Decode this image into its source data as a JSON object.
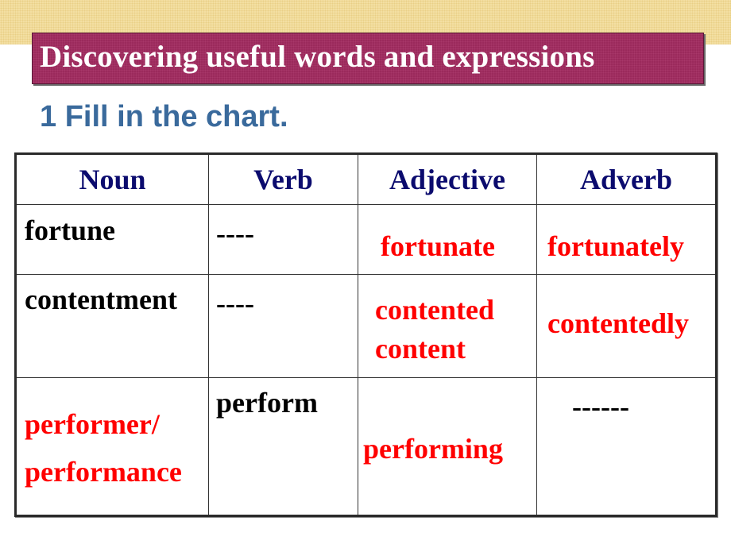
{
  "slide": {
    "title": "Discovering useful words and expressions",
    "subtitle": "1 Fill in the chart.",
    "colors": {
      "band": "#f3dfa2",
      "title_box": "#9b2a5c",
      "title_text": "#ffffff",
      "subtitle": "#3a6a9c",
      "header_text": "#0b0b6e",
      "given_text": "#000000",
      "answer_text": "#ff0000"
    }
  },
  "chart": {
    "headers": [
      "Noun",
      "Verb",
      "Adjective",
      "Adverb"
    ],
    "rows": [
      {
        "noun": {
          "text": "fortune",
          "answer": false
        },
        "verb": {
          "text": "----",
          "answer": false
        },
        "adjective": {
          "text": "fortunate",
          "answer": true
        },
        "adverb": {
          "text": "fortunately",
          "answer": true
        }
      },
      {
        "noun": {
          "text": "contentment",
          "answer": false
        },
        "verb": {
          "text": "----",
          "answer": false
        },
        "adjective": {
          "line1": "contented",
          "line2": "content",
          "answer": true
        },
        "adverb": {
          "text": "contentedly",
          "answer": true
        }
      },
      {
        "noun": {
          "line1": "performer/",
          "line2": "performance",
          "answer": true
        },
        "verb": {
          "text": "perform",
          "answer": false
        },
        "adjective": {
          "text": "performing",
          "answer": true
        },
        "adverb": {
          "text": "------",
          "answer": false
        }
      }
    ]
  }
}
